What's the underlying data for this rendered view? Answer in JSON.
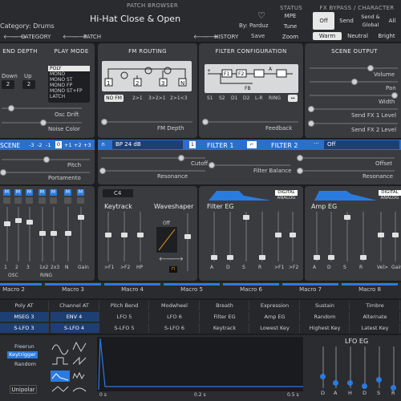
{
  "header": {
    "patch_browser_label": "PATCH BROWSER",
    "category_value": "Category: Drums",
    "patch_name": "Hi-Hat Close & Open",
    "author": "By: Parduz",
    "category_nav": "CATEGORY",
    "patch_nav": "PATCH",
    "history": "HISTORY",
    "save": "Save",
    "status_label": "STATUS",
    "status_items": [
      "MPE",
      "Tune",
      "Zoom"
    ],
    "fx_label": "FX BYPASS / CHARACTER",
    "fx_buttons": [
      "Off",
      "Send",
      "Send & Global",
      "All"
    ],
    "character": [
      "Warm",
      "Neutral",
      "Bright"
    ]
  },
  "sections": {
    "bend_depth": "END DEPTH",
    "bend_down": "Down",
    "bend_up": "Up",
    "bend_down_val": "2",
    "bend_up_val": "2",
    "play_mode": "PLAY MODE",
    "play_modes": [
      "POLY",
      "MONO",
      "MONO ST",
      "MONO FP",
      "MONO ST+FP",
      "LATCH"
    ],
    "osc_drift": "Osc Drift",
    "noise_color": "Noise Color",
    "fm_routing": "FM ROUTING",
    "fm_options": [
      "NO FM",
      "2>1",
      "3>2>1",
      "2>1<3"
    ],
    "fm_depth": "FM Depth",
    "filter_config": "FILTER CONFIGURATION",
    "filter_labels": [
      "S1",
      "S2",
      "D1",
      "D2",
      "L-R",
      "RING"
    ],
    "feedback": "Feedback",
    "scene_output": "SCENE OUTPUT",
    "scene_outs": [
      "Volume",
      "Pan",
      "Width",
      "Send FX 1 Level",
      "Send FX 2 Level"
    ]
  },
  "scene_bar": {
    "scene": "SCENE",
    "octaves": [
      "-3",
      "-2",
      "-1",
      "0",
      "+1",
      "+2",
      "+3"
    ],
    "pitch": "Pitch",
    "portamento": "Portamento",
    "filter1_type": "BP 24 dB",
    "filter1_label": "FILTER 1",
    "filter1_num": "1",
    "filter2_label": "FILTER 2",
    "filter2_type": "Off",
    "cutoff": "Cutoff",
    "resonance": "Resonance",
    "filter_balance": "Filter Balance",
    "offset": "Offset",
    "resonance2": "Resonance"
  },
  "mixer": {
    "mutes": [
      "M",
      "M",
      "M",
      "M",
      "M",
      "M",
      "M"
    ],
    "labels": [
      "1",
      "2",
      "3",
      "1x2",
      "2x3",
      "N",
      "Gain"
    ],
    "osc": "OSC",
    "ring": "RING"
  },
  "keytrack": {
    "note": "C4",
    "label": "Keytrack",
    "sliders": [
      ">F1",
      ">F2",
      "HP"
    ]
  },
  "waveshaper": {
    "label": "Waveshaper",
    "mode": "Off"
  },
  "filter_eg": {
    "label": "Filter EG",
    "digital": "DIGITAL",
    "analog": "ANALOG",
    "sliders": [
      "A",
      "D",
      "S",
      "R",
      ">F1",
      ">F2"
    ]
  },
  "amp_eg": {
    "label": "Amp EG",
    "digital": "DIGITAL",
    "analog": "ANALOG",
    "sliders": [
      "A",
      "D",
      "S",
      "R",
      "Vel>",
      "Gain"
    ]
  },
  "macros": [
    "Macro 2",
    "Macro 3",
    "Macro 4",
    "Macro 5",
    "Macro 6",
    "Macro 7",
    "Macro 8"
  ],
  "mod_row1": [
    "Poly AT",
    "Channel AT",
    "Pitch Bend",
    "Modwheel",
    "Breath",
    "Expression",
    "Sustain",
    "Timbre"
  ],
  "mod_row2": [
    "MSEG 3",
    "ENV 4",
    "LFO 5",
    "LFO 6",
    "Filter EG",
    "Amp EG",
    "Random",
    "Alternate"
  ],
  "mod_row3": [
    "S-LFO 3",
    "S-LFO 4",
    "S-LFO 5",
    "S-LFO 6",
    "Keytrack",
    "Lowest Key",
    "Highest Key",
    "Latest Key"
  ],
  "lfo": {
    "triggers": [
      "Freerun",
      "Keytrigger",
      "Random"
    ],
    "unipolar": "Unipolar",
    "times": [
      "0 s",
      "0.2 s",
      "0.5 s"
    ],
    "eg_label": "LFO EG",
    "eg_sliders": [
      "D",
      "A",
      "H",
      "D",
      "S",
      "R"
    ]
  },
  "colors": {
    "accent": "#2a7be0",
    "panel": "#3a3b3f",
    "background": "#1c1d20"
  }
}
